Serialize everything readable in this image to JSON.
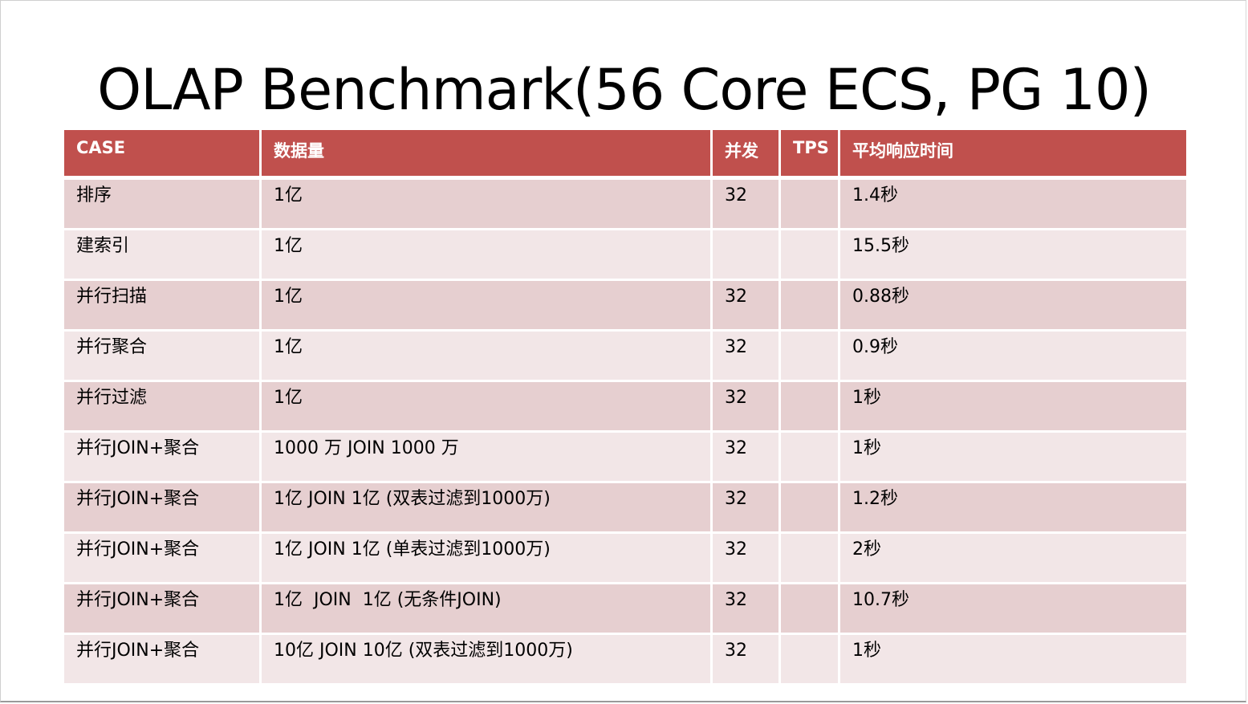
{
  "slide": {
    "title": "OLAP Benchmark(56 Core ECS, PG 10)"
  },
  "table": {
    "headers": {
      "case": "CASE",
      "data_volume": "数据量",
      "concurrency": "并发",
      "tps": "TPS",
      "avg_response_time": "平均响应时间"
    },
    "rows": [
      {
        "case": "排序",
        "data_volume": "1亿",
        "concurrency": "32",
        "tps": "",
        "avg_response_time": "1.4秒"
      },
      {
        "case": "建索引",
        "data_volume": "1亿",
        "concurrency": "",
        "tps": "",
        "avg_response_time": "15.5秒"
      },
      {
        "case": "并行扫描",
        "data_volume": "1亿",
        "concurrency": "32",
        "tps": "",
        "avg_response_time": "0.88秒"
      },
      {
        "case": "并行聚合",
        "data_volume": "1亿",
        "concurrency": "32",
        "tps": "",
        "avg_response_time": "0.9秒"
      },
      {
        "case": "并行过滤",
        "data_volume": "1亿",
        "concurrency": "32",
        "tps": "",
        "avg_response_time": "1秒"
      },
      {
        "case": "并行JOIN+聚合",
        "data_volume": "1000 万 JOIN 1000 万",
        "concurrency": "32",
        "tps": "",
        "avg_response_time": "1秒"
      },
      {
        "case": "并行JOIN+聚合",
        "data_volume": "1亿 JOIN 1亿 (双表过滤到1000万)",
        "concurrency": "32",
        "tps": "",
        "avg_response_time": "1.2秒"
      },
      {
        "case": "并行JOIN+聚合",
        "data_volume": "1亿 JOIN 1亿 (单表过滤到1000万)",
        "concurrency": "32",
        "tps": "",
        "avg_response_time": "2秒"
      },
      {
        "case": "并行JOIN+聚合",
        "data_volume": "1亿  JOIN  1亿 (无条件JOIN)",
        "concurrency": "32",
        "tps": "",
        "avg_response_time": "10.7秒"
      },
      {
        "case": "并行JOIN+聚合",
        "data_volume": "10亿 JOIN 10亿 (双表过滤到1000万)",
        "concurrency": "32",
        "tps": "",
        "avg_response_time": "1秒"
      }
    ]
  },
  "colors": {
    "header_bg": "#c0504d",
    "row_odd_bg": "#e6cfd0",
    "row_even_bg": "#f2e6e7"
  }
}
